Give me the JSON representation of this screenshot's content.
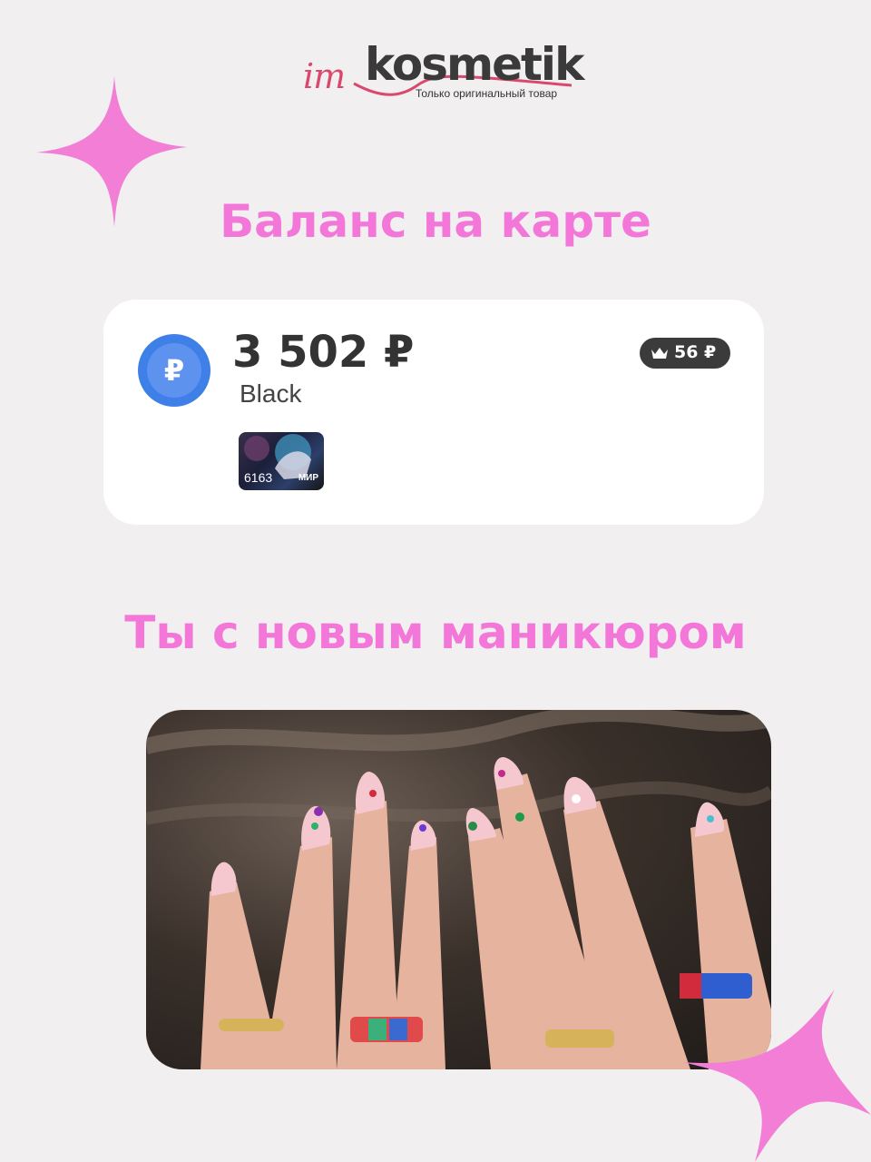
{
  "brand": {
    "prefix": "im",
    "name": "kosmetik",
    "tagline": "Только оригинальный товар"
  },
  "headings": {
    "balance": "Баланс на карте",
    "manicure": "Ты с новым маникюром"
  },
  "card": {
    "currency_symbol": "₽",
    "amount": "3 502 ₽",
    "tier": "Black",
    "bonus": "56 ₽",
    "card_last_digits": "6163",
    "payment_system": "МИР"
  },
  "colors": {
    "background": "#f1efef",
    "accent_pink": "#f277d9",
    "star_pink": "#f27ed6",
    "brand_red": "#d9496e",
    "coin_blue": "#3f7fe8"
  },
  "icons": [
    "star-icon",
    "ruble-coin-icon",
    "crown-icon"
  ]
}
